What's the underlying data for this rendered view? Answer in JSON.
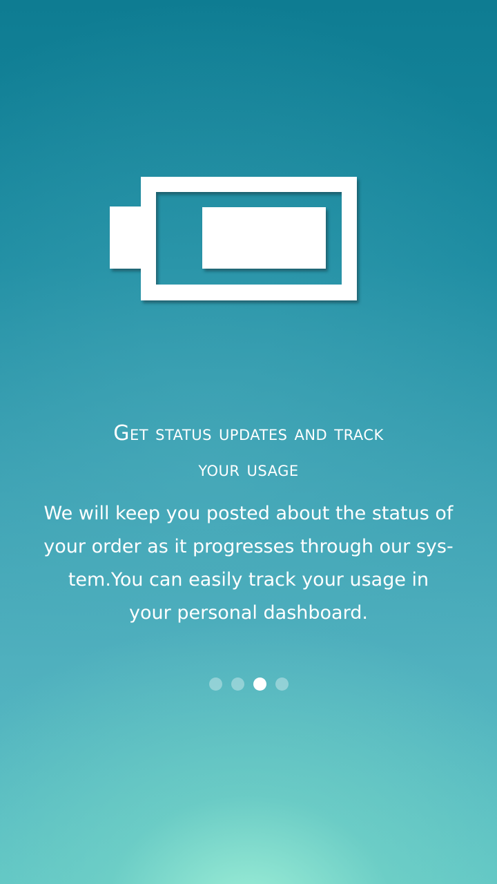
{
  "onboarding": {
    "icon": "battery-half-icon",
    "title_lines": [
      "Get status updates and track",
      "your usage"
    ],
    "body_lines": [
      "We will keep you posted about the status of",
      "your order as it progresses through our sys-",
      "tem.You can easily track your usage in",
      "your personal dashboard."
    ],
    "pager": {
      "total_pages": 4,
      "active_page": 3
    }
  },
  "colors": {
    "bg_top": "#0e7c92",
    "bg_bottom_glow": "#a0f0d7",
    "foreground": "#ffffff"
  }
}
